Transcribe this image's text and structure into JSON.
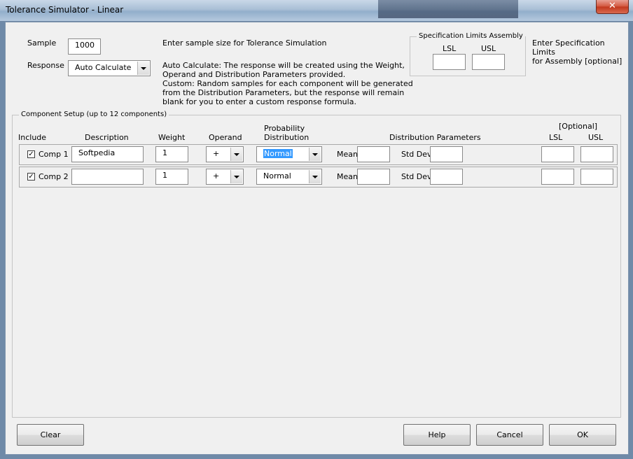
{
  "window": {
    "title": "Tolerance Simulator - Linear",
    "close_glyph": "✕"
  },
  "sample": {
    "label": "Sample",
    "value": "1000",
    "hint": "Enter sample size for Tolerance Simulation"
  },
  "response": {
    "label": "Response",
    "value": "Auto Calculate",
    "desc_lines": [
      "Auto Calculate:  The response will be created using the Weight,",
      "Operand and Distribution Parameters provided.",
      "Custom:  Random samples for each component will be generated",
      "from the Distribution Parameters, but the response will remain",
      "blank for you to enter a custom response formula."
    ]
  },
  "spec_limits": {
    "title": "Specification Limits Assembly",
    "lsl_label": "LSL",
    "usl_label": "USL",
    "hint_lines": [
      "Enter Specification Limits",
      "for Assembly [optional]"
    ]
  },
  "component_setup": {
    "title": "Component Setup (up to 12 components)",
    "headers": {
      "include": "Include",
      "description": "Description",
      "weight": "Weight",
      "operand": "Operand",
      "prob_line1": "Probability",
      "prob_line2": "Distribution",
      "dist_params": "Distribution Parameters",
      "optional": "[Optional]",
      "lsl": "LSL",
      "usl": "USL"
    },
    "mean_label": "Mean",
    "stddev_label": "Std Dev",
    "rows": [
      {
        "checked": "✓",
        "name": "Comp 1",
        "description": "Softpedia",
        "weight": "1",
        "operand": "+",
        "distribution": "Normal"
      },
      {
        "checked": "✓",
        "name": "Comp 2",
        "description": "",
        "weight": "1",
        "operand": "+",
        "distribution": "Normal"
      }
    ]
  },
  "buttons": {
    "clear": "Clear",
    "help": "Help",
    "cancel": "Cancel",
    "ok": "OK"
  }
}
